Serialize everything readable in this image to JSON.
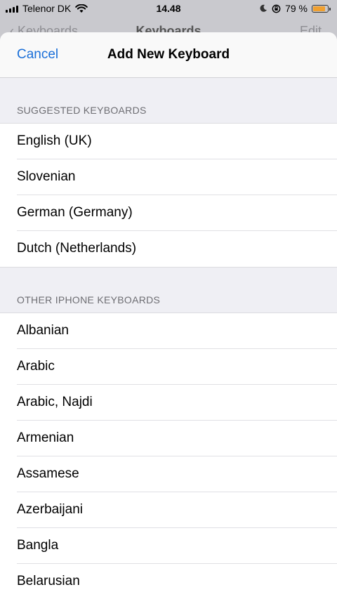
{
  "status": {
    "carrier": "Telenor DK",
    "time": "14.48",
    "battery_percent": "79 %",
    "battery_level": 0.79
  },
  "background_nav": {
    "back_label": "Keyboards",
    "title": "Keyboards",
    "edit_label": "Edit"
  },
  "sheet": {
    "cancel_label": "Cancel",
    "title": "Add New Keyboard"
  },
  "sections": {
    "suggested": {
      "header": "SUGGESTED KEYBOARDS",
      "items": [
        "English (UK)",
        "Slovenian",
        "German (Germany)",
        "Dutch (Netherlands)"
      ]
    },
    "other": {
      "header": "OTHER IPHONE KEYBOARDS",
      "items": [
        "Albanian",
        "Arabic",
        "Arabic, Najdi",
        "Armenian",
        "Assamese",
        "Azerbaijani",
        "Bangla",
        "Belarusian"
      ]
    }
  },
  "colors": {
    "accent": "#1a6fd8",
    "battery": "#f0a030"
  }
}
